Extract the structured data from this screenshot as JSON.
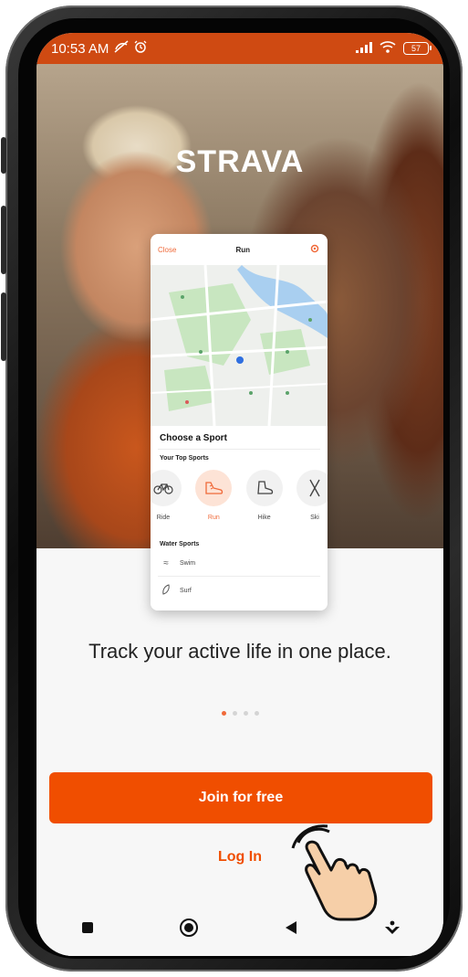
{
  "status_bar": {
    "time": "10:53 AM",
    "battery": "57",
    "accent": "#cf4a12"
  },
  "app": {
    "logo": "STRAVA",
    "brand_color": "#f04e00"
  },
  "preview": {
    "close_label": "Close",
    "title": "Run",
    "sheet_title": "Choose a Sport",
    "top_sports_label": "Your Top Sports",
    "sports": [
      {
        "label": "Ride",
        "icon": "bike-icon",
        "selected": false
      },
      {
        "label": "Run",
        "icon": "shoe-icon",
        "selected": true
      },
      {
        "label": "Hike",
        "icon": "boot-icon",
        "selected": false
      },
      {
        "label": "Ski",
        "icon": "ski-icon",
        "selected": false
      }
    ],
    "water_label": "Water Sports",
    "water_sports": [
      {
        "label": "Swim",
        "icon": "swim-icon"
      },
      {
        "label": "Surf",
        "icon": "surf-icon"
      }
    ]
  },
  "onboarding": {
    "tagline": "Track your active life in one place.",
    "page_index": 1,
    "page_count": 4
  },
  "actions": {
    "join_label": "Join for free",
    "login_label": "Log In"
  },
  "nav": {
    "icons": [
      "recents-icon",
      "home-icon",
      "back-icon",
      "assistant-icon"
    ]
  }
}
